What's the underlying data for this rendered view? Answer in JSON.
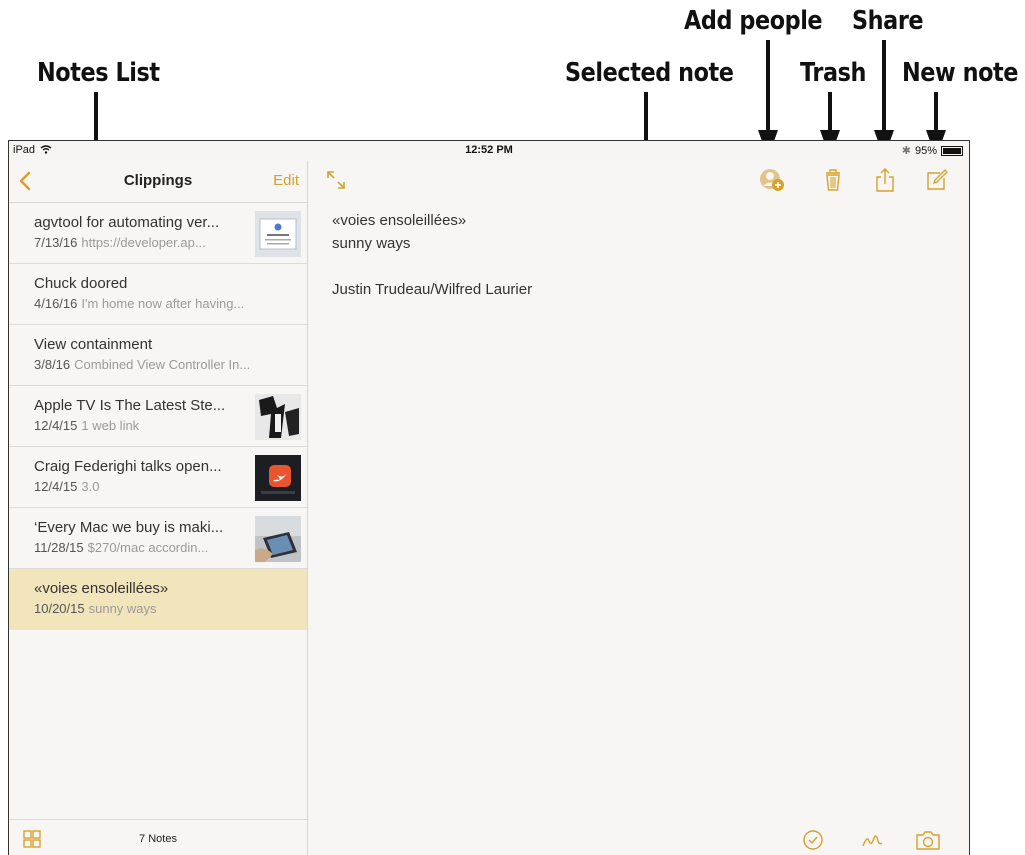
{
  "callouts": {
    "notes_list": "Notes List",
    "selected_note": "Selected note",
    "add_people": "Add people",
    "trash": "Trash",
    "share": "Share",
    "new_note": "New note"
  },
  "status_bar": {
    "device": "iPad",
    "time": "12:52 PM",
    "battery": "95%"
  },
  "sidebar": {
    "title": "Clippings",
    "edit_label": "Edit",
    "notes_count": "7 Notes",
    "notes": [
      {
        "title": "agvtool for automating ver...",
        "date": "7/13/16",
        "preview": "https://developer.ap...",
        "thumbnail": "document-thumbnail"
      },
      {
        "title": "Chuck doored",
        "date": "4/16/16",
        "preview": "I'm home now after having..."
      },
      {
        "title": "View containment",
        "date": "3/8/16",
        "preview": "Combined View Controller In..."
      },
      {
        "title": "Apple TV Is The Latest Ste...",
        "date": "12/4/15",
        "preview": "1 web link",
        "thumbnail": "dark-photo-thumbnail"
      },
      {
        "title": "Craig Federighi talks open...",
        "date": "12/4/15",
        "preview": "3.0",
        "thumbnail": "swift-logo-thumbnail"
      },
      {
        "title": "‘Every Mac we buy is maki...",
        "date": "11/28/15",
        "preview": "$270/mac accordin...",
        "thumbnail": "ipad-photo-thumbnail"
      },
      {
        "title": "«voies ensoleillées»",
        "date": "10/20/15",
        "preview": "sunny ways",
        "selected": true
      }
    ]
  },
  "note": {
    "line1": "«voies ensoleillées»",
    "line2": "sunny ways",
    "line3": "Justin Trudeau/Wilfred Laurier"
  },
  "icons": {
    "back": "chevron-left-icon",
    "expand": "expand-arrows-icon",
    "add_people": "add-person-icon",
    "trash": "trash-icon",
    "share": "share-icon",
    "new_note": "compose-icon",
    "grid": "grid-icon",
    "checklist": "checkmark-circle-icon",
    "sketch": "sketch-icon",
    "camera": "camera-icon"
  },
  "colors": {
    "accent": "#d6a22c",
    "selected_row": "#f3e5bb",
    "background": "#f7f6f4"
  }
}
